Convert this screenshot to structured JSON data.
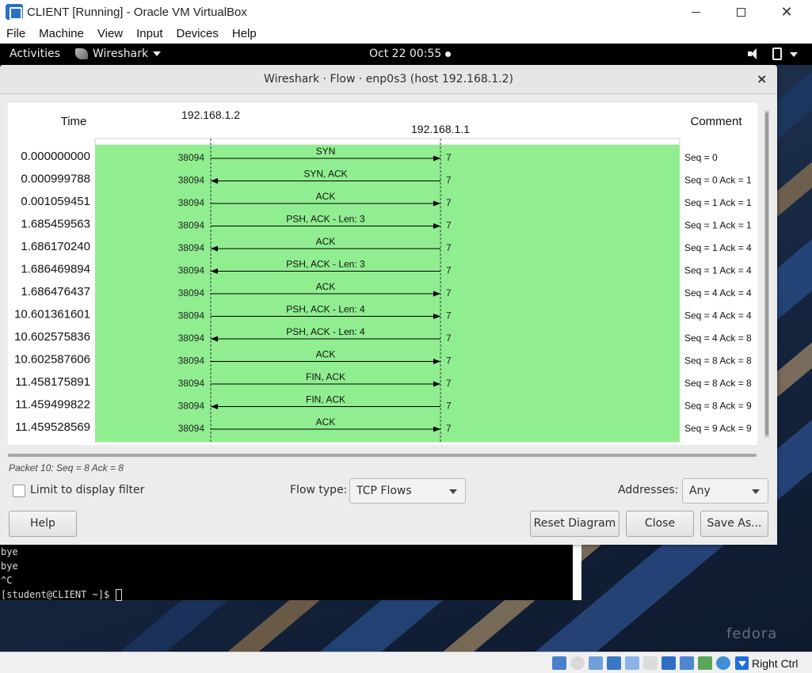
{
  "vbox": {
    "title": "CLIENT [Running] - Oracle VM VirtualBox",
    "menu": [
      "File",
      "Machine",
      "View",
      "Input",
      "Devices",
      "Help"
    ],
    "host_key": "Right Ctrl"
  },
  "gnome": {
    "activities": "Activities",
    "app_name": "Wireshark",
    "clock": "Oct 22  00:55"
  },
  "dialog": {
    "title": "Wireshark · Flow · enp0s3 (host 192.168.1.2)",
    "close_glyph": "×",
    "packet_info": "Packet 10: Seq = 8 Ack = 8",
    "limit_label": "Limit to display filter",
    "flow_type_label": "Flow type:",
    "flow_type_value": "TCP Flows",
    "addresses_label": "Addresses:",
    "addresses_value": "Any",
    "buttons": {
      "help": "Help",
      "reset": "Reset Diagram",
      "close": "Close",
      "save_as": "Save As..."
    }
  },
  "flow": {
    "time_header": "Time",
    "comment_header": "Comment",
    "host_a": "192.168.1.2",
    "host_b": "192.168.1.1",
    "highlight_color": "#90ee90",
    "rows": [
      {
        "time": "0.000000000",
        "src_port": "38094",
        "dst_port": "7",
        "label": "SYN",
        "dir": "right",
        "comment": "Seq = 0"
      },
      {
        "time": "0.000999788",
        "src_port": "38094",
        "dst_port": "7",
        "label": "SYN, ACK",
        "dir": "left",
        "comment": "Seq = 0 Ack = 1"
      },
      {
        "time": "0.001059451",
        "src_port": "38094",
        "dst_port": "7",
        "label": "ACK",
        "dir": "right",
        "comment": "Seq = 1 Ack = 1"
      },
      {
        "time": "1.685459563",
        "src_port": "38094",
        "dst_port": "7",
        "label": "PSH, ACK - Len: 3",
        "dir": "right",
        "comment": "Seq = 1 Ack = 1"
      },
      {
        "time": "1.686170240",
        "src_port": "38094",
        "dst_port": "7",
        "label": "ACK",
        "dir": "left",
        "comment": "Seq = 1 Ack = 4"
      },
      {
        "time": "1.686469894",
        "src_port": "38094",
        "dst_port": "7",
        "label": "PSH, ACK - Len: 3",
        "dir": "left",
        "comment": "Seq = 1 Ack = 4"
      },
      {
        "time": "1.686476437",
        "src_port": "38094",
        "dst_port": "7",
        "label": "ACK",
        "dir": "right",
        "comment": "Seq = 4 Ack = 4"
      },
      {
        "time": "10.601361601",
        "src_port": "38094",
        "dst_port": "7",
        "label": "PSH, ACK - Len: 4",
        "dir": "right",
        "comment": "Seq = 4 Ack = 4"
      },
      {
        "time": "10.602575836",
        "src_port": "38094",
        "dst_port": "7",
        "label": "PSH, ACK - Len: 4",
        "dir": "left",
        "comment": "Seq = 4 Ack = 8"
      },
      {
        "time": "10.602587606",
        "src_port": "38094",
        "dst_port": "7",
        "label": "ACK",
        "dir": "right",
        "comment": "Seq = 8 Ack = 8"
      },
      {
        "time": "11.458175891",
        "src_port": "38094",
        "dst_port": "7",
        "label": "FIN, ACK",
        "dir": "right",
        "comment": "Seq = 8 Ack = 8"
      },
      {
        "time": "11.459499822",
        "src_port": "38094",
        "dst_port": "7",
        "label": "FIN, ACK",
        "dir": "left",
        "comment": "Seq = 8 Ack = 9"
      },
      {
        "time": "11.459528569",
        "src_port": "38094",
        "dst_port": "7",
        "label": "ACK",
        "dir": "right",
        "comment": "Seq = 9 Ack = 9"
      }
    ]
  },
  "terminal": {
    "lines": [
      "bye",
      "bye",
      "^C",
      "[student@CLIENT ~]$ "
    ]
  },
  "fedora_logo": "fedora"
}
